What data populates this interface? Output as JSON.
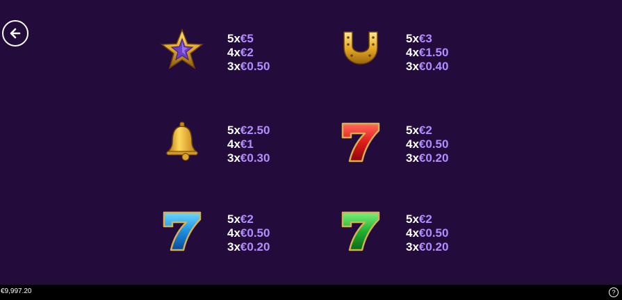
{
  "colors": {
    "background": "#230c3b",
    "count_text": "#ffffff",
    "amount_text": "#b38cff",
    "bottom_bar": "#000000"
  },
  "back_button": {
    "icon": "arrow-left-icon"
  },
  "paytable": [
    {
      "symbol": "star-icon",
      "pays": [
        {
          "count": "5x",
          "amount": "€5"
        },
        {
          "count": "4x",
          "amount": "€2"
        },
        {
          "count": "3x",
          "amount": "€0.50"
        }
      ]
    },
    {
      "symbol": "horseshoe-icon",
      "pays": [
        {
          "count": "5x",
          "amount": "€3"
        },
        {
          "count": "4x",
          "amount": "€1.50"
        },
        {
          "count": "3x",
          "amount": "€0.40"
        }
      ]
    },
    {
      "symbol": "bell-icon",
      "pays": [
        {
          "count": "5x",
          "amount": "€2.50"
        },
        {
          "count": "4x",
          "amount": "€1"
        },
        {
          "count": "3x",
          "amount": "€0.30"
        }
      ]
    },
    {
      "symbol": "red-seven-icon",
      "pays": [
        {
          "count": "5x",
          "amount": "€2"
        },
        {
          "count": "4x",
          "amount": "€0.50"
        },
        {
          "count": "3x",
          "amount": "€0.20"
        }
      ]
    },
    {
      "symbol": "blue-seven-icon",
      "pays": [
        {
          "count": "5x",
          "amount": "€2"
        },
        {
          "count": "4x",
          "amount": "€0.50"
        },
        {
          "count": "3x",
          "amount": "€0.20"
        }
      ]
    },
    {
      "symbol": "green-seven-icon",
      "pays": [
        {
          "count": "5x",
          "amount": "€2"
        },
        {
          "count": "4x",
          "amount": "€0.50"
        },
        {
          "count": "3x",
          "amount": "€0.20"
        }
      ]
    }
  ],
  "bottom_bar": {
    "balance": "€9,997.20",
    "help_label": "?"
  }
}
